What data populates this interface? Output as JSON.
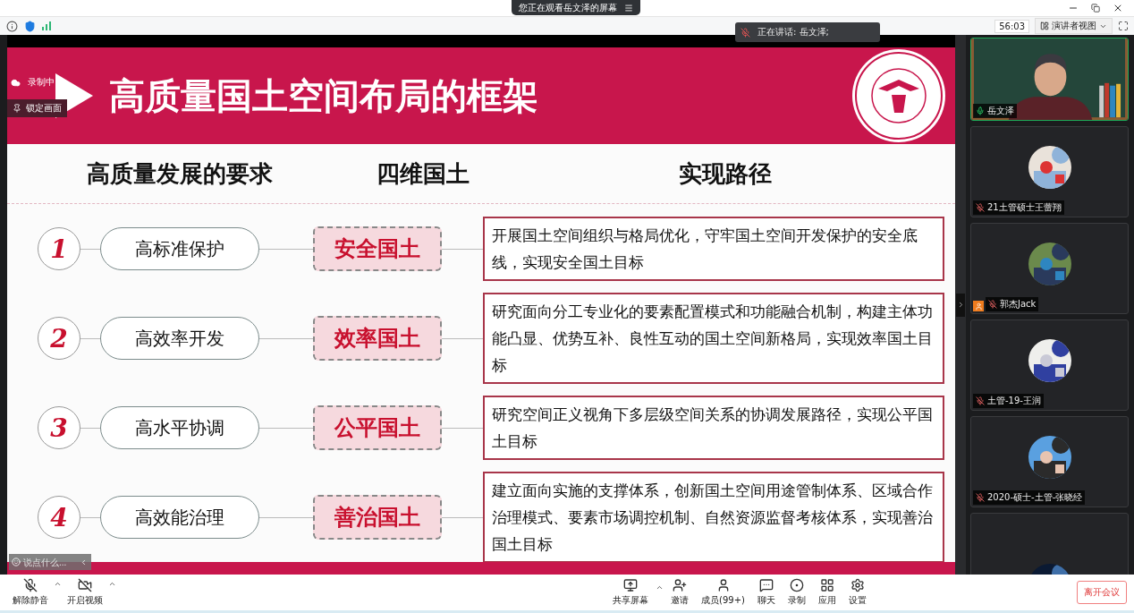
{
  "window": {
    "banner": "您正在观看岳文泽的屏幕"
  },
  "toolbar": {
    "timer": "56:03",
    "view_label": "演讲者视图"
  },
  "speaking": {
    "text": "正在讲话: 岳文泽;"
  },
  "recording": {
    "label": "录制中"
  },
  "lock_button": {
    "label": "锁定画面"
  },
  "chat_input": {
    "placeholder": "说点什么..."
  },
  "slide": {
    "title": "高质量国土空间布局的框架",
    "headers": [
      "高质量发展的要求",
      "四维国土",
      "实现路径"
    ],
    "rows": [
      {
        "number": "1",
        "requirement": "高标准保护",
        "territory": "安全国土",
        "path": "开展国土空间组织与格局优化，守牢国土空间开发保护的安全底线，实现安全国土目标"
      },
      {
        "number": "2",
        "requirement": "高效率开发",
        "territory": "效率国土",
        "path": "研究面向分工专业化的要素配置模式和功能融合机制，构建主体功能凸显、优势互补、良性互动的国土空间新格局，实现效率国土目标"
      },
      {
        "number": "3",
        "requirement": "高水平协调",
        "territory": "公平国土",
        "path": "研究空间正义视角下多层级空间关系的协调发展路径，实现公平国土目标"
      },
      {
        "number": "4",
        "requirement": "高效能治理",
        "territory": "善治国土",
        "path": "建立面向实施的支撑体系，创新国土空间用途管制体系、区域合作治理模式、要素市场调控机制、自然资源监督考核体系，实现善治国土目标"
      }
    ]
  },
  "participants": [
    {
      "name": "岳文泽",
      "kind": "video",
      "muted": false,
      "host_badge": false
    },
    {
      "name": "21土管硕士王蕾翔",
      "kind": "avatar",
      "muted": true,
      "host_badge": false
    },
    {
      "name": "郭杰Jack",
      "kind": "avatar",
      "muted": true,
      "host_badge": true
    },
    {
      "name": "土管-19-王润",
      "kind": "avatar",
      "muted": true,
      "host_badge": false
    },
    {
      "name": "2020-硕士-土管-张晓经",
      "kind": "avatar",
      "muted": true,
      "host_badge": false
    },
    {
      "kind": "avatar_cut"
    }
  ],
  "bottom_left": [
    {
      "label": "解除静音",
      "kind": "mic",
      "off": true
    },
    {
      "label": "开启视频",
      "kind": "video",
      "off": true
    }
  ],
  "bottom_center": [
    {
      "label": "共享屏幕",
      "kind": "share"
    },
    {
      "label": "邀请",
      "kind": "invite"
    },
    {
      "label": "成员(99+)",
      "kind": "members"
    },
    {
      "label": "聊天",
      "kind": "chat"
    },
    {
      "label": "录制",
      "kind": "record"
    },
    {
      "label": "应用",
      "kind": "apps"
    },
    {
      "label": "设置",
      "kind": "settings"
    }
  ],
  "leave_button": {
    "label": "离开会议"
  }
}
